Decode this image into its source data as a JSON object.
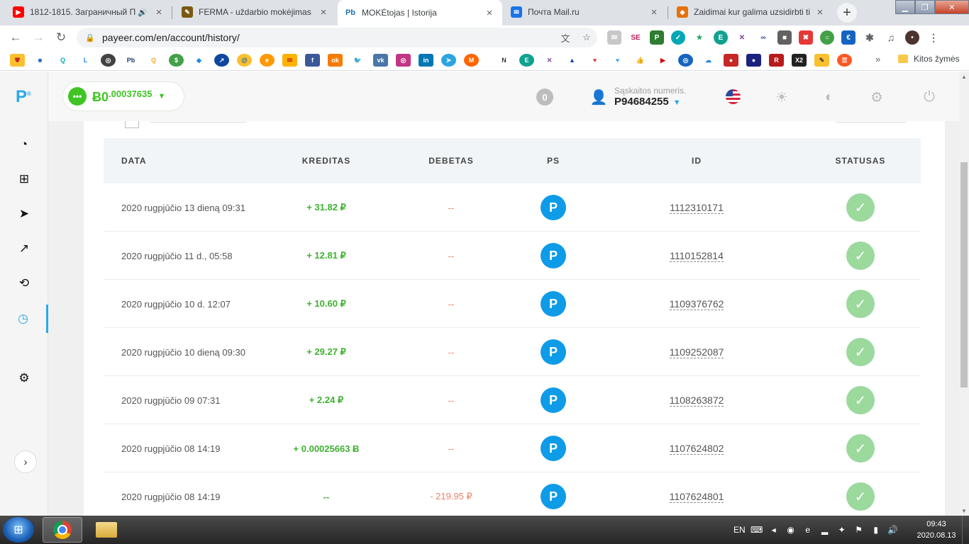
{
  "browser": {
    "tabs": [
      {
        "title": "1812-1815. Заграничный П",
        "favicon": "youtube-icon",
        "color": "#ff0000",
        "glyph": "▶"
      },
      {
        "title": "FERMA - uždarbio mokėjimas",
        "favicon": "ferma-icon",
        "color": "#7a5a12",
        "glyph": "✎"
      },
      {
        "title": "MOKĖtojas | Istorija",
        "favicon": "payeer-icon",
        "color": "#1f6fb5",
        "glyph": "Pb"
      },
      {
        "title": "Почта Mail.ru",
        "favicon": "mail-icon",
        "color": "#1a73e8",
        "glyph": "✉"
      },
      {
        "title": "Zaidimai kur galima uzsidirbti ti",
        "favicon": "game-icon",
        "color": "#e8710a",
        "glyph": "◆"
      }
    ],
    "url": "payeer.com/en/account/history/",
    "bookmarks_folder": "Kitos žymės",
    "more": "»"
  },
  "header": {
    "balance_main": "Ƀ0",
    "balance_decimals": ".00037635",
    "notifications": "0",
    "account_label": "Sąskaitos numeris.",
    "account_number": "P94684255"
  },
  "table": {
    "headers": {
      "date": "DATA",
      "credit": "KREDITAS",
      "debit": "DEBETAS",
      "ps": "PS",
      "id": "ID",
      "status": "STATUSAS"
    },
    "rows": [
      {
        "date": "2020 rugpjūčio 13 dieną 09:31",
        "credit": "+ 31.82 ₽",
        "debit": "--",
        "ps": "P",
        "id": "1112310171"
      },
      {
        "date": "2020 rugpjūčio 11 d., 05:58",
        "credit": "+ 12.81 ₽",
        "debit": "--",
        "ps": "P",
        "id": "1110152814"
      },
      {
        "date": "2020 rugpjūčio 10 d. 12:07",
        "credit": "+ 10.60 ₽",
        "debit": "--",
        "ps": "P",
        "id": "1109376762"
      },
      {
        "date": "2020 rugpjūčio 10 dieną 09:30",
        "credit": "+ 29.27 ₽",
        "debit": "--",
        "ps": "P",
        "id": "1109252087"
      },
      {
        "date": "2020 rugpjūčio 09 07:31",
        "credit": "+ 2.24 ₽",
        "debit": "--",
        "ps": "P",
        "id": "1108263872"
      },
      {
        "date": "2020 rugpjūčio 08 14:19",
        "credit": "+ 0.00025663 Ƀ",
        "debit": "--",
        "ps": "P",
        "id": "1107624802"
      },
      {
        "date": "2020 rugpjūčio 08 14:19",
        "credit": "--",
        "debit": "- 219.95 ₽",
        "ps": "P",
        "id": "1107624801"
      }
    ]
  },
  "taskbar": {
    "language": "EN",
    "time": "09:43",
    "date": "2020.08.13"
  },
  "colors": {
    "accent": "#2aa8e8",
    "credit": "#3fb130",
    "debit": "#f0806b",
    "ps_badge": "#0e9be8",
    "status_ok": "#9bd99d"
  }
}
